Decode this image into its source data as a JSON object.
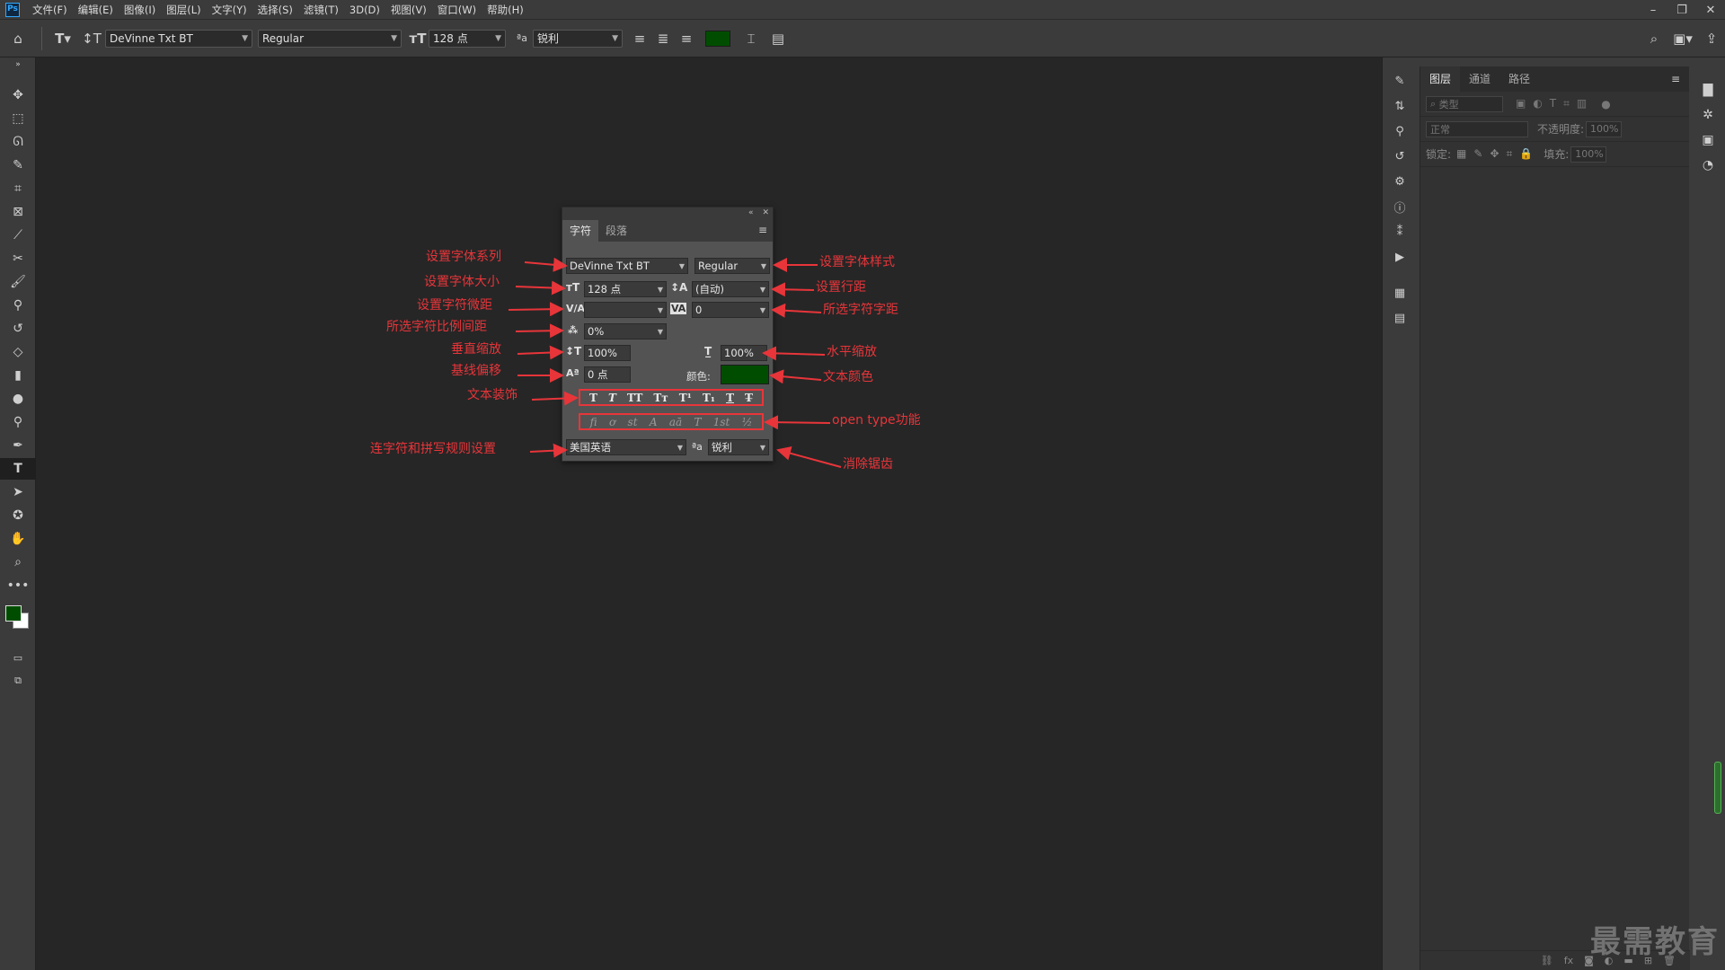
{
  "menubar": {
    "logo": "Ps",
    "items": [
      "文件(F)",
      "编辑(E)",
      "图像(I)",
      "图层(L)",
      "文字(Y)",
      "选择(S)",
      "滤镜(T)",
      "3D(D)",
      "视图(V)",
      "窗口(W)",
      "帮助(H)"
    ]
  },
  "window_controls": {
    "minimize": "–",
    "restore": "❐",
    "close": "✕"
  },
  "options_bar": {
    "font_family": "DeVinne Txt BT",
    "font_style": "Regular",
    "font_size": "128 点",
    "antialias": "锐利",
    "text_color": "#004d00"
  },
  "character_panel": {
    "tabs": [
      "字符",
      "段落"
    ],
    "font_family": "DeVinne Txt BT",
    "font_style": "Regular",
    "font_size": "128 点",
    "leading": "(自动)",
    "kerning": "",
    "tracking": "0",
    "proportional_spacing": "0%",
    "vertical_scale": "100%",
    "horizontal_scale": "100%",
    "baseline_shift": "0 点",
    "color_label": "颜色:",
    "color": "#004d00",
    "decoration_glyphs": [
      "T",
      "T",
      "TT",
      "Tт",
      "T¹",
      "T₁",
      "T",
      "T̶"
    ],
    "opentype_glyphs": [
      "fi",
      "ơ",
      "st",
      "A",
      "aā",
      "T",
      "1st",
      "½"
    ],
    "language": "美国英语",
    "aa_icon": "ªa",
    "antialias": "锐利"
  },
  "annotations": {
    "font_family": "设置字体系列",
    "font_size": "设置字体大小",
    "kerning": "设置字符微距",
    "proportional": "所选字符比例间距",
    "vertical_scale": "垂直缩放",
    "baseline_shift": "基线偏移",
    "text_decoration": "文本装饰",
    "hyphenation": "连字符和拼写规则设置",
    "font_style": "设置字体样式",
    "leading": "设置行距",
    "tracking": "所选字符字距",
    "horizontal_scale": "水平缩放",
    "text_color": "文本颜色",
    "opentype": "open type功能",
    "antialias": "消除锯齿"
  },
  "layers_panel": {
    "tabs": [
      "图层",
      "通道",
      "路径"
    ],
    "filter_label": "类型",
    "blend_mode": "正常",
    "opacity_label": "不透明度:",
    "opacity_value": "100%",
    "lock_label": "锁定:",
    "fill_label": "填充:",
    "fill_value": "100%"
  },
  "watermark": "最需教育",
  "accent_annotation_color": "#e8353a"
}
